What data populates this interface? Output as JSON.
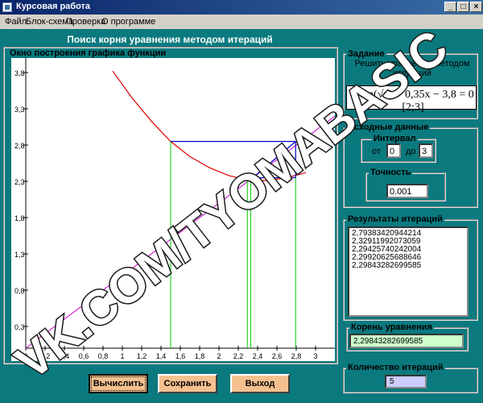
{
  "window": {
    "title": "Курсовая работа"
  },
  "menu": {
    "items": [
      "Файл",
      "Блок-схема",
      "Проверка",
      "О программе"
    ]
  },
  "header": {
    "title": "Поиск корня уравнения методом итераций"
  },
  "graph": {
    "label": "Окно построения графика функции",
    "y_ticks": [
      "3,8",
      "3,3",
      "2,8",
      "2,3",
      "1,8",
      "1,3",
      "0,8",
      "0,3"
    ],
    "x_ticks": [
      "0",
      "0,2",
      "0,4",
      "0,6",
      "0,8",
      "1",
      "1,2",
      "1,4",
      "1,6",
      "1,8",
      "2",
      "2,2",
      "2,4",
      "2,6",
      "2,8",
      "3"
    ],
    "colors": {
      "curve": "#e00000",
      "line": "#cc00cc",
      "iteration": "#0000cc",
      "verticals": "#00cc00"
    }
  },
  "chart_data": {
    "type": "line",
    "xlim": [
      0,
      3
    ],
    "ylim": [
      0,
      4
    ],
    "x_ticks": [
      0,
      0.2,
      0.4,
      0.6,
      0.8,
      1,
      1.2,
      1.4,
      1.6,
      1.8,
      2,
      2.2,
      2.4,
      2.6,
      2.8,
      3
    ],
    "y_ticks": [
      3.8,
      3.3,
      2.8,
      2.3,
      1.8,
      1.3,
      0.8,
      0.3
    ],
    "series": [
      {
        "values": [
          [
            0.9,
            3.82
          ],
          [
            1.1,
            3.45
          ],
          [
            1.3,
            3.13
          ],
          [
            1.5,
            2.85
          ],
          [
            1.7,
            2.64
          ],
          [
            1.9,
            2.49
          ],
          [
            2.1,
            2.38
          ],
          [
            2.3,
            2.32
          ],
          [
            2.5,
            2.31
          ],
          [
            2.7,
            2.35
          ],
          [
            2.9,
            2.42
          ]
        ]
      },
      {
        "values": [
          [
            0,
            0
          ],
          [
            3.3,
            3.3
          ]
        ]
      }
    ],
    "iteration_points": [
      2.79383420944214,
      2.32911992073059,
      2.29425740242004,
      2.29920625688646,
      2.29843282699585
    ]
  },
  "task": {
    "label": "Задание",
    "instruction": "Решить уравнение методом итераций",
    "equation": "3 sin(√x) + 0,35x − 3,8 = 0   [2;3]"
  },
  "input": {
    "label": "Исходные данные",
    "interval_label": "Интервал",
    "from_label": "от",
    "from_value": "0",
    "to_label": "до",
    "to_value": "3",
    "precision_label": "Точность",
    "precision_value": "0.001"
  },
  "results": {
    "label": "Результаты итераций",
    "values": [
      "2,79383420944214",
      "2,32911992073059",
      "2,29425740242004",
      "2,29920625688646",
      "2,29843282699585"
    ]
  },
  "root": {
    "label": "Корень уравнения",
    "value": "2,29843282699585"
  },
  "count": {
    "label": "Количество итераций",
    "value": "5"
  },
  "buttons": {
    "calculate": "Вычислить",
    "save": "Сохранить",
    "exit": "Выход"
  },
  "watermark": {
    "text": "VK.COM/TYOMABASIC"
  }
}
